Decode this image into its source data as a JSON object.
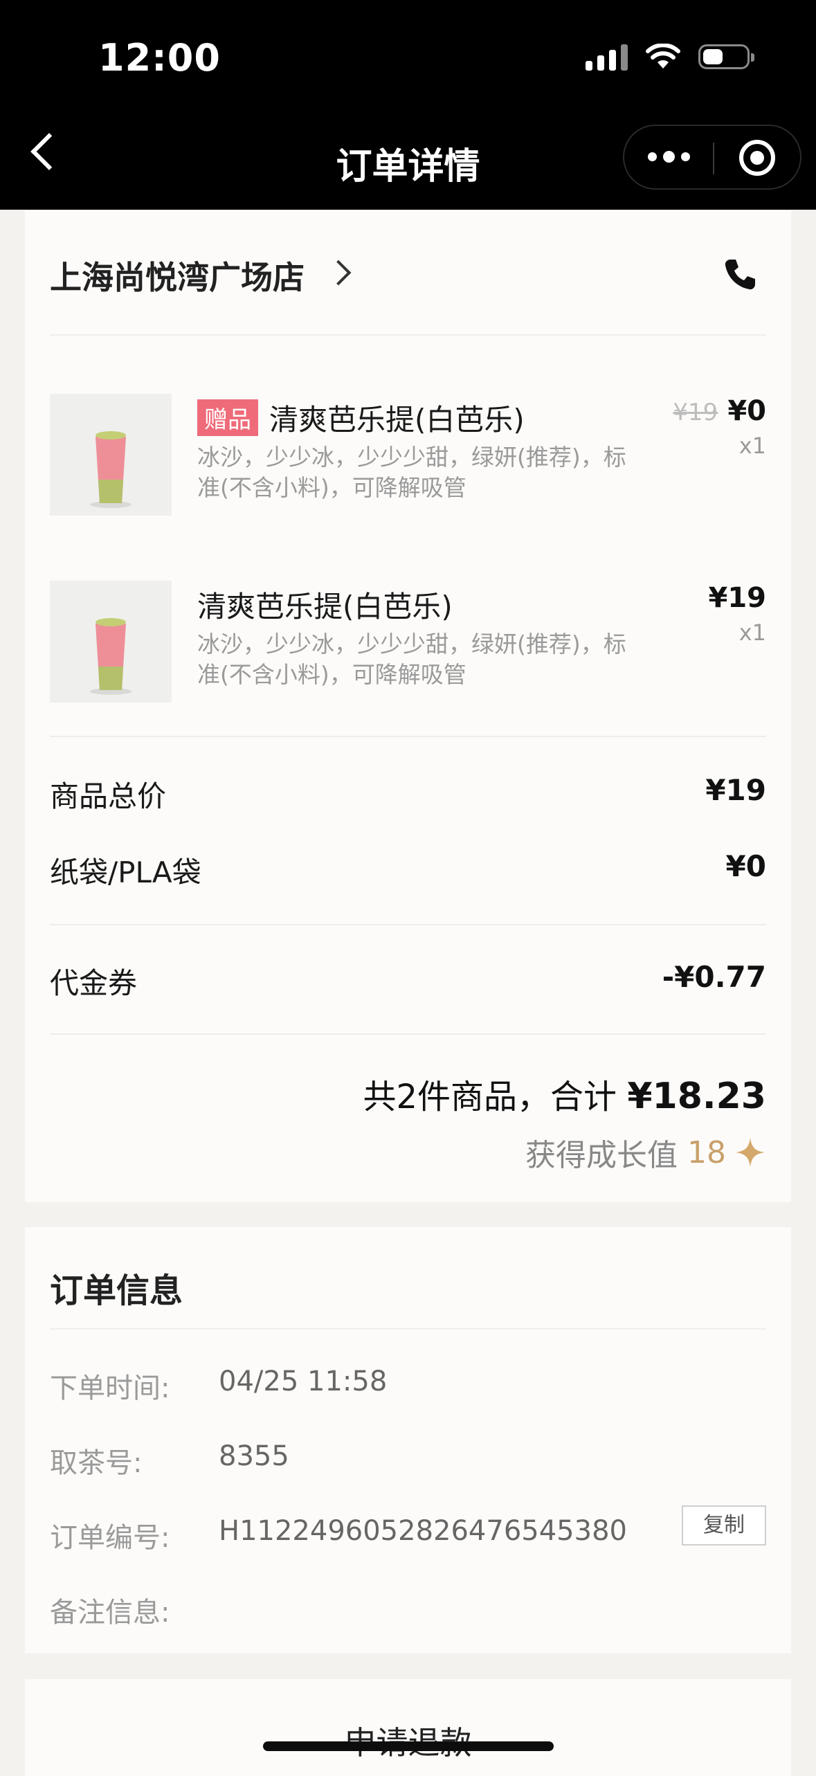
{
  "status_bar": {
    "time": "12:00"
  },
  "nav": {
    "title": "订单详情"
  },
  "store": {
    "name": "上海尚悦湾广场店"
  },
  "items": [
    {
      "badge": "赠品",
      "name": "清爽芭乐提(白芭乐)",
      "spec": "冰沙，少少冰，少少少甜，绿妍(推荐)，标准(不含小料)，可降解吸管",
      "original_price": "¥19",
      "price": "¥0",
      "qty": "x1"
    },
    {
      "badge": "",
      "name": "清爽芭乐提(白芭乐)",
      "spec": "冰沙，少少冰，少少少甜，绿妍(推荐)，标准(不含小料)，可降解吸管",
      "original_price": "",
      "price": "¥19",
      "qty": "x1"
    }
  ],
  "summary": {
    "goods_total_label": "商品总价",
    "goods_total": "¥19",
    "bag_label": "纸袋/PLA袋",
    "bag_price": "¥0",
    "voucher_label": "代金券",
    "voucher_value": "-¥0.77",
    "total_prefix": "共2件商品，合计",
    "total_amount": "¥18.23",
    "growth_label": "获得成长值",
    "growth_value": "18"
  },
  "order_info": {
    "title": "订单信息",
    "time_label": "下单时间:",
    "time_value": "04/25 11:58",
    "pickup_label": "取茶号:",
    "pickup_value": "8355",
    "order_no_label": "订单编号:",
    "order_no_value": "H1122496052826476545380",
    "copy_label": "复制",
    "remark_label": "备注信息:",
    "remark_value": ""
  },
  "refund": {
    "label": "申请退款"
  },
  "colors": {
    "badge": "#ef6b7a",
    "growth": "#c9a06a"
  }
}
